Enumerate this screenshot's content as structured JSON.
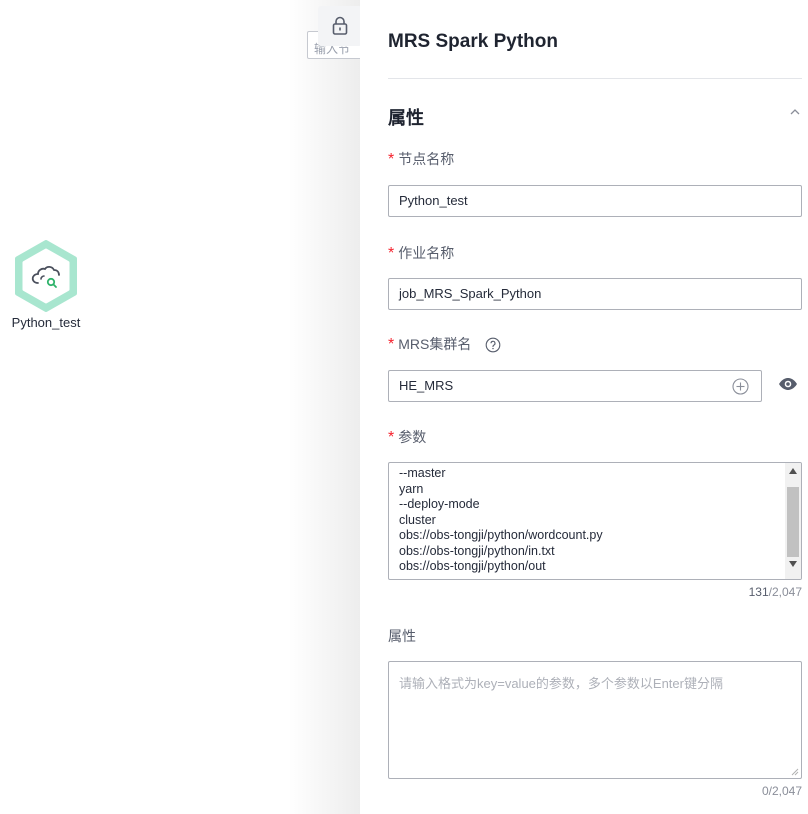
{
  "canvas": {
    "search_placeholder": "输入节",
    "node": {
      "label": "Python_test",
      "icon": "mrs-spark-python-icon",
      "accent": "#a8e6cf"
    }
  },
  "panel": {
    "title": "MRS Spark Python",
    "section_title": "属性",
    "fields": {
      "node_name": {
        "label": "节点名称",
        "value": "Python_test"
      },
      "job_name": {
        "label": "作业名称",
        "value": "job_MRS_Spark_Python"
      },
      "cluster": {
        "label": "MRS集群名",
        "value": "HE_MRS"
      },
      "params": {
        "label": "参数",
        "lines": [
          "--master",
          "yarn",
          "--deploy-mode",
          "cluster",
          "obs://obs-tongji/python/wordcount.py",
          "obs://obs-tongji/python/in.txt",
          "obs://obs-tongji/python/out"
        ],
        "count": "131",
        "max": "/2,047"
      },
      "properties": {
        "label": "属性",
        "placeholder": "请输入格式为key=value的参数，多个参数以Enter键分隔",
        "count": "0/2,047"
      }
    },
    "required_mark": "*",
    "colors": {
      "required": "#f5222d",
      "border": "#adb0b8"
    }
  }
}
